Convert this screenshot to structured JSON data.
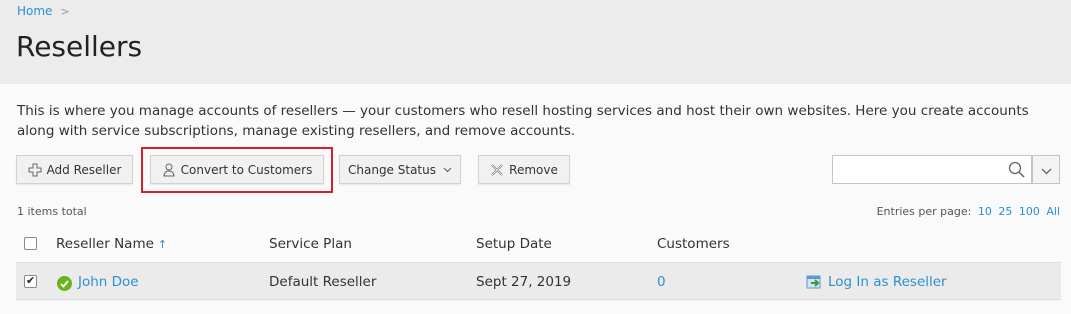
{
  "breadcrumb": {
    "home": "Home",
    "separator": ">"
  },
  "page": {
    "title": "Resellers",
    "description": "This is where you manage accounts of resellers — your customers who resell hosting services and host their own websites. Here you create accounts along with service subscriptions, manage existing resellers, and remove accounts."
  },
  "toolbar": {
    "add_label": "Add Reseller",
    "convert_label": "Convert to Customers",
    "status_label": "Change Status",
    "remove_label": "Remove"
  },
  "search": {
    "placeholder": "",
    "value": ""
  },
  "list": {
    "total": "1 items total",
    "per_page_label": "Entries per page:",
    "per_page_options": [
      "10",
      "25",
      "100",
      "All"
    ]
  },
  "table": {
    "columns": [
      "Reseller Name",
      "Service Plan",
      "Setup Date",
      "Customers"
    ],
    "sort_indicator": "↑",
    "rows": [
      {
        "selected": true,
        "status": "active",
        "name": "John Doe",
        "plan": "Default Reseller",
        "date": "Sept 27, 2019",
        "customers": "0",
        "action": "Log In as Reseller"
      }
    ]
  },
  "colors": {
    "link": "#2c8fd6",
    "highlight": "#d2202e",
    "status_ok": "#6ab31e",
    "header_bg": "#ececec"
  },
  "icons": [
    "add-icon",
    "convert-user-icon",
    "chevron-down-icon",
    "remove-icon",
    "search-icon",
    "status-ok-icon",
    "login-icon"
  ]
}
